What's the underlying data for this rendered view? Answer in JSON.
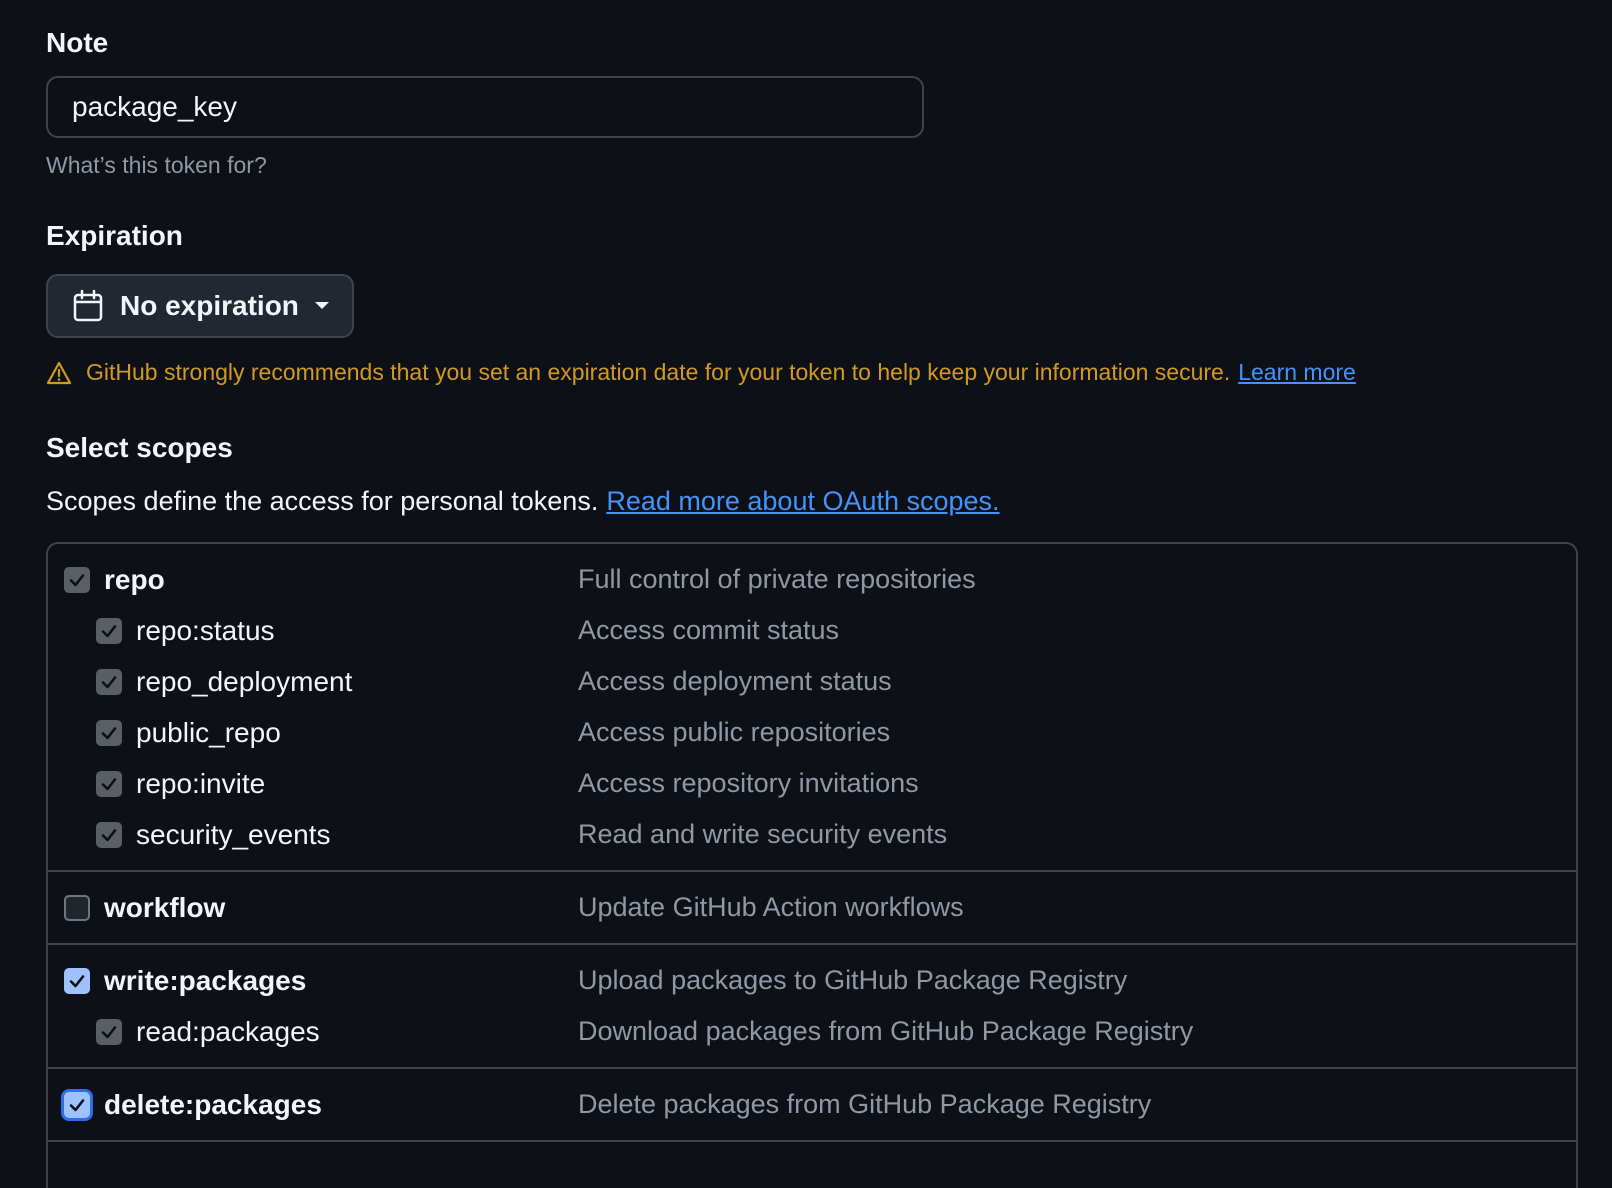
{
  "note": {
    "label": "Note",
    "value": "package_key",
    "help": "What’s this token for?"
  },
  "expiration": {
    "label": "Expiration",
    "selected": "No expiration",
    "warning": "GitHub strongly recommends that you set an expiration date for your token to help keep your information secure.",
    "learn_more": "Learn more"
  },
  "scopes": {
    "label": "Select scopes",
    "description": "Scopes define the access for personal tokens.",
    "link": "Read more about OAuth scopes.",
    "groups": [
      {
        "items": [
          {
            "name": "repo",
            "desc": "Full control of private repositories",
            "level": "top",
            "checked": true
          },
          {
            "name": "repo:status",
            "desc": "Access commit status",
            "level": "sub",
            "checked": true
          },
          {
            "name": "repo_deployment",
            "desc": "Access deployment status",
            "level": "sub",
            "checked": true
          },
          {
            "name": "public_repo",
            "desc": "Access public repositories",
            "level": "sub",
            "checked": true
          },
          {
            "name": "repo:invite",
            "desc": "Access repository invitations",
            "level": "sub",
            "checked": true
          },
          {
            "name": "security_events",
            "desc": "Read and write security events",
            "level": "sub",
            "checked": true
          }
        ]
      },
      {
        "items": [
          {
            "name": "workflow",
            "desc": "Update GitHub Action workflows",
            "level": "top",
            "checked": false
          }
        ]
      },
      {
        "items": [
          {
            "name": "write:packages",
            "desc": "Upload packages to GitHub Package Registry",
            "level": "top",
            "checked": true
          },
          {
            "name": "read:packages",
            "desc": "Download packages from GitHub Package Registry",
            "level": "sub",
            "checked": true
          }
        ]
      },
      {
        "items": [
          {
            "name": "delete:packages",
            "desc": "Delete packages from GitHub Package Registry",
            "level": "top",
            "checked": true
          }
        ]
      }
    ]
  },
  "colors": {
    "background": "#0d1117",
    "warning": "#d29922",
    "link": "#4493f8",
    "checkbox_active": "#9fc2ff",
    "checkbox_disabled": "#5a5f66"
  }
}
